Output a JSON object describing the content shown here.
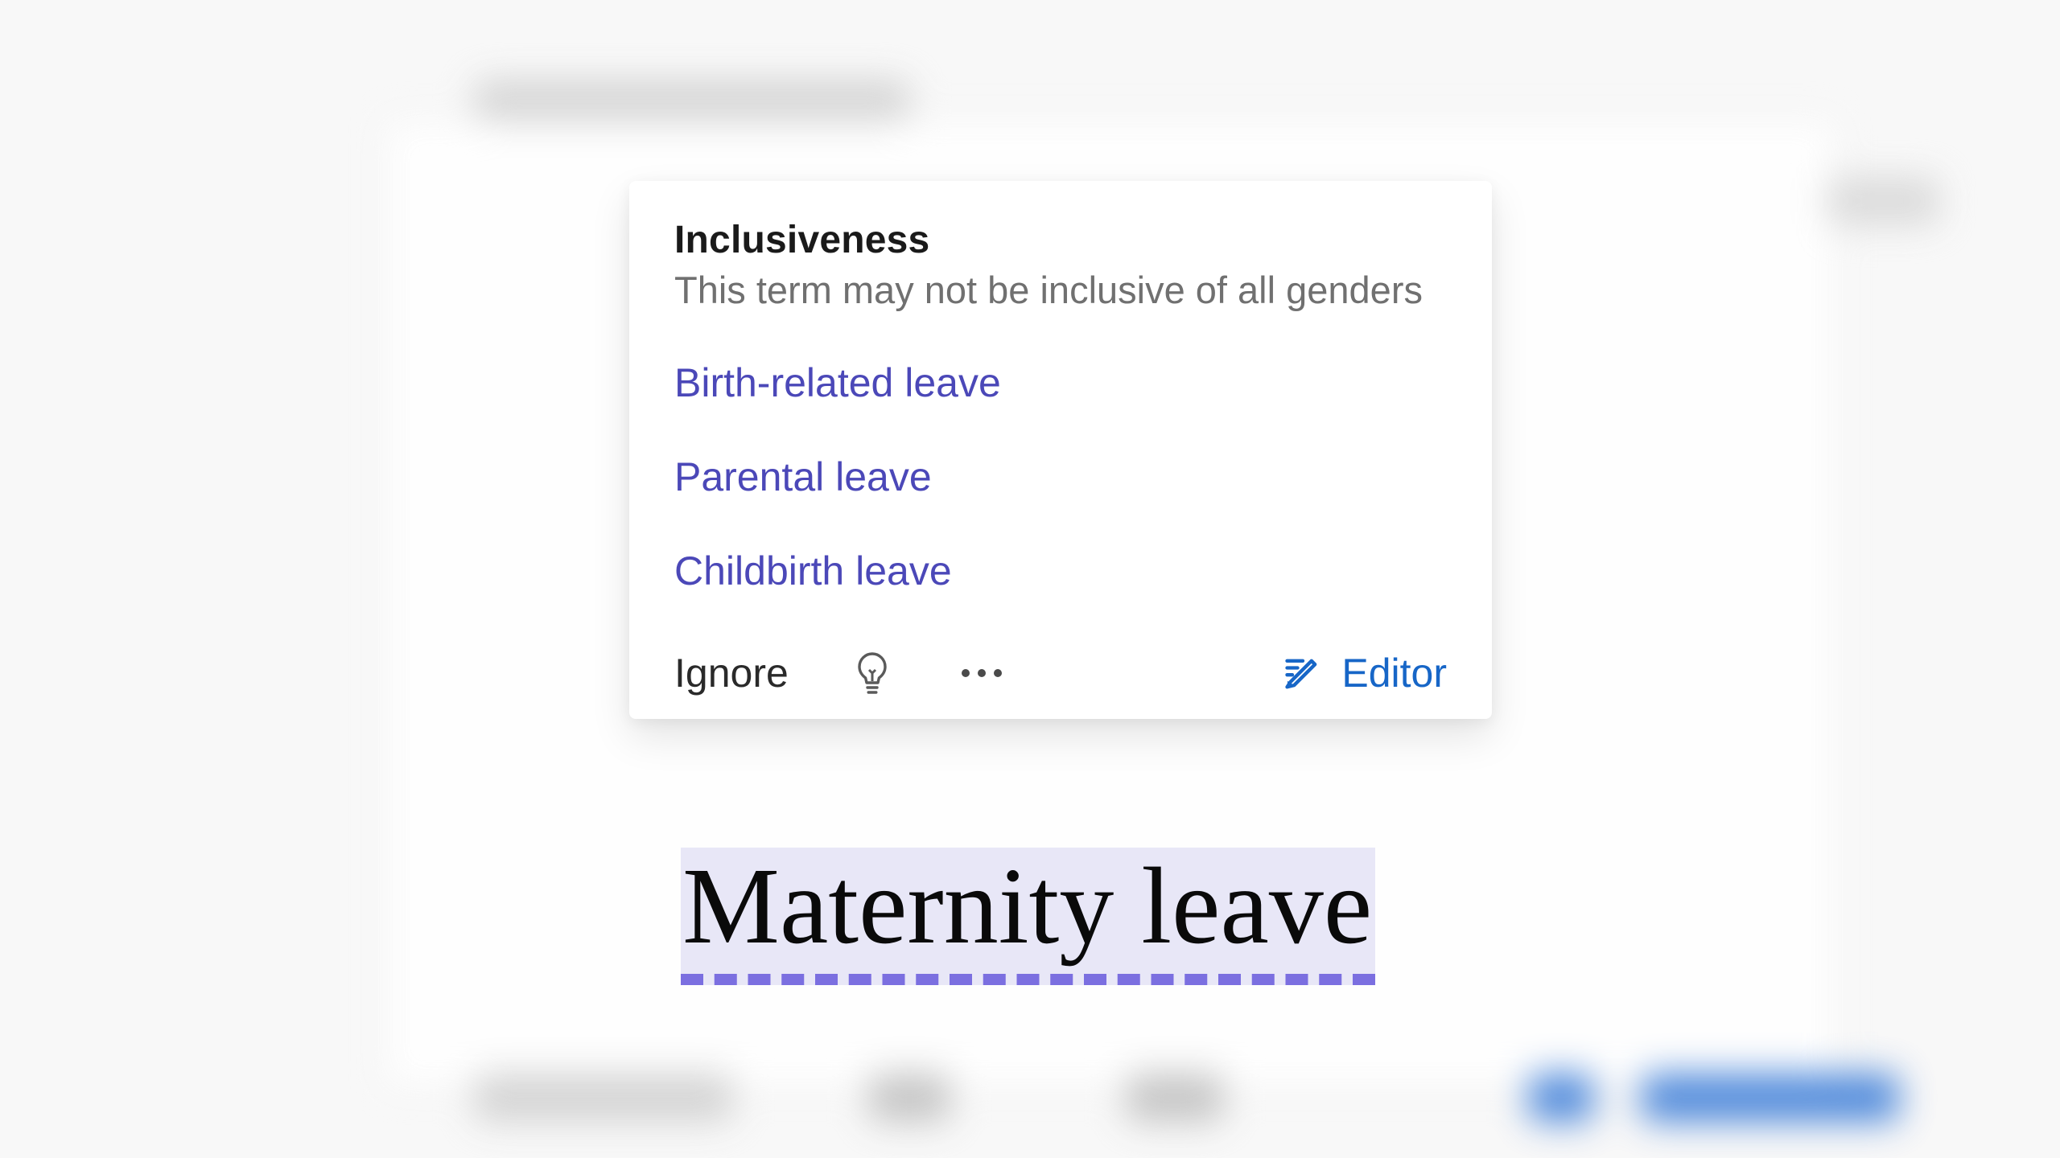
{
  "flagged_text": "Maternity leave",
  "popup": {
    "category": "Inclusiveness",
    "description": "This term may not be inclusive of all genders",
    "suggestions": [
      "Birth-related leave",
      "Parental leave",
      "Childbirth leave"
    ],
    "ignore_label": "Ignore",
    "editor_label": "Editor"
  },
  "colors": {
    "suggestion_text": "#4b48b8",
    "underline": "#7b6fe0",
    "editor_link": "#1766c7"
  }
}
